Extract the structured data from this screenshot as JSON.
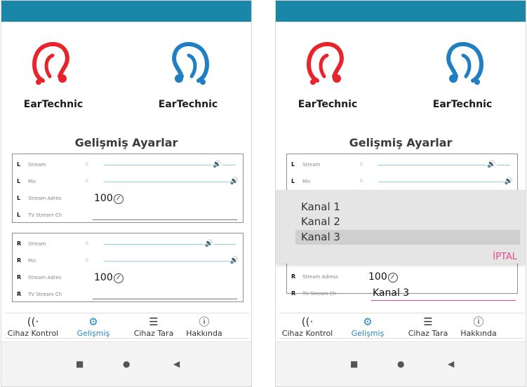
{
  "colors": {
    "header": "#1a87a9",
    "active": "#1f89c6",
    "accent_pink": "#e8478b",
    "left_ear": "#e8232c",
    "right_ear": "#1f7fc2"
  },
  "screens": [
    {
      "brand": {
        "left": "EarTechnic",
        "right": "EarTechnic"
      },
      "title": "Gelişmiş Ayarlar",
      "left_panel": {
        "side": "L",
        "stream": {
          "label": "Stream",
          "zero": "0",
          "level": 0.88
        },
        "mic": {
          "label": "Mic",
          "zero": "0",
          "level": 1.0
        },
        "stream_address": {
          "label": "Stream Adres",
          "value": "100"
        },
        "tv_stream": {
          "label": "TV Stream Ch",
          "value": ""
        }
      },
      "right_panel": {
        "side": "R",
        "stream": {
          "label": "Stream",
          "zero": "0",
          "level": 0.8
        },
        "mic": {
          "label": "Mic",
          "zero": "0",
          "level": 1.0
        },
        "stream_address": {
          "label": "Stream Adres",
          "value": "100"
        },
        "tv_stream": {
          "label": "TV Stream Ch",
          "value": ""
        }
      },
      "nav": [
        {
          "label": "Cihaz Kontrol",
          "icon": "ear-icon",
          "active": false
        },
        {
          "label": "Gelişmiş",
          "icon": "gear-icon",
          "active": true
        },
        {
          "label": "Cihaz Tara",
          "icon": "list-icon",
          "active": false
        },
        {
          "label": "Hakkında",
          "icon": "info-icon",
          "active": false
        }
      ]
    },
    {
      "brand": {
        "left": "EarTechnic",
        "right": "EarTechnic"
      },
      "title": "Gelişmiş Ayarlar",
      "left_panel": {
        "side": "L",
        "stream": {
          "label": "Stream",
          "zero": "0",
          "level": 0.88
        },
        "mic": {
          "label": "Mic",
          "zero": "0",
          "level": 1.0
        }
      },
      "right_panel": {
        "side": "R",
        "stream_address": {
          "label": "Stream Adress",
          "value": "100"
        },
        "tv_stream": {
          "label": "TV Stream Ch",
          "value": "Kanal 3"
        }
      },
      "picker": {
        "options": [
          "Kanal 1",
          "Kanal 2",
          "Kanal 3"
        ],
        "selected_index": 2,
        "cancel": "İPTAL"
      },
      "nav": [
        {
          "label": "Cihaz Kontrol",
          "icon": "ear-icon",
          "active": false
        },
        {
          "label": "Gelişmiş",
          "icon": "gear-icon",
          "active": true
        },
        {
          "label": "Cihaz Tara",
          "icon": "list-icon",
          "active": false
        },
        {
          "label": "Hakkında",
          "icon": "info-icon",
          "active": false
        }
      ]
    }
  ]
}
